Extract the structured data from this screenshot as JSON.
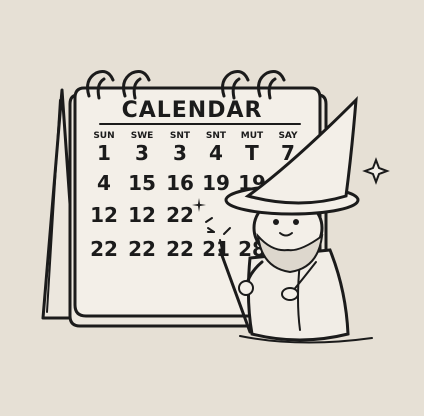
{
  "calendar": {
    "title": "CALENDAR",
    "weekdays": [
      "SUN",
      "SWE",
      "SNT",
      "SNT",
      "MUT",
      "SAY"
    ],
    "rows": [
      [
        "1",
        "3",
        "3",
        "4",
        "T",
        "7"
      ],
      [
        "4",
        "15",
        "16",
        "19",
        "19"
      ],
      [
        "12",
        "12",
        "22"
      ],
      [
        "22",
        "22",
        "22",
        "21",
        "28"
      ]
    ]
  },
  "icons": [
    "calendar-ring-icon",
    "wizard-hat-icon",
    "magic-wand-icon",
    "sparkle-icon"
  ],
  "colors": {
    "background": "#e6e0d5",
    "ink": "#1b1b1b",
    "paper": "#f3efe8"
  }
}
